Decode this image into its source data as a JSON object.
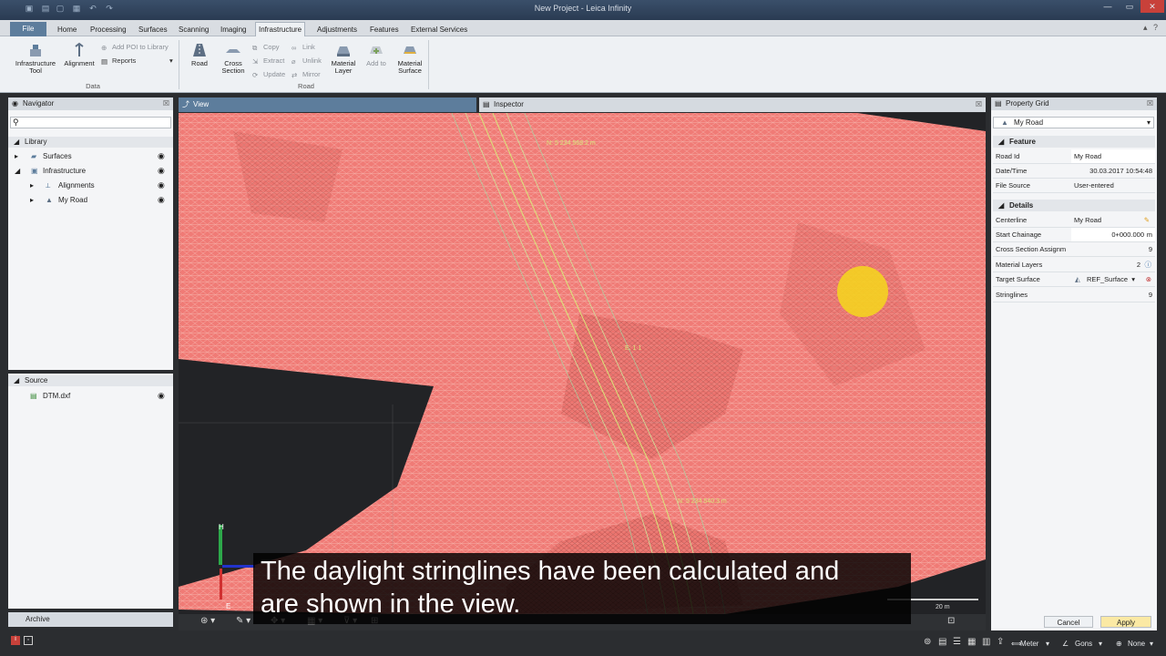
{
  "window": {
    "title": "New Project - Leica Infinity"
  },
  "ribbon_tabs": [
    "File",
    "Home",
    "Processing",
    "Surfaces",
    "Scanning",
    "Imaging",
    "Infrastructure",
    "Adjustments",
    "Features",
    "External Services"
  ],
  "ribbon": {
    "infrastructure_tool": "Infrastructure Tool",
    "alignment": "Alignment",
    "add_poi": "Add POI to Library",
    "reports": "Reports",
    "data_group": "Data",
    "road": "Road",
    "cross_section": "Cross Section",
    "copy": "Copy",
    "extract": "Extract",
    "update": "Update",
    "link": "Link",
    "unlink": "Unlink",
    "mirror": "Mirror",
    "material_layer": "Material Layer",
    "add_to": "Add to",
    "material_surface": "Material Surface",
    "road_group": "Road"
  },
  "navigator": {
    "title": "Navigator",
    "library": "Library",
    "items": [
      "Surfaces",
      "Infrastructure",
      "Alignments",
      "My Road"
    ],
    "source_title": "Source",
    "source_items": [
      "DTM.dxf"
    ],
    "archive": "Archive"
  },
  "view_tabs": {
    "view": "View",
    "inspector": "Inspector"
  },
  "viewport": {
    "annotations": [
      "N: 5 234 568.2 m",
      "N: 5 234 540.3 m",
      "E: 1 1"
    ],
    "scale": "20 m",
    "axis_h": "H",
    "axis_e": "E"
  },
  "subtitle": {
    "line1": "The daylight stringlines have been calculated and",
    "line2": "are shown in the view."
  },
  "property_grid": {
    "title": "Property Grid",
    "selector": "My Road",
    "feature_section": "Feature",
    "details_section": "Details",
    "feature": [
      {
        "k": "Road Id",
        "v": "My Road"
      },
      {
        "k": "Date/Time",
        "v": "30.03.2017 10:54:48"
      },
      {
        "k": "File Source",
        "v": "User-entered"
      }
    ],
    "details": [
      {
        "k": "Centerline",
        "v": "My Road"
      },
      {
        "k": "Start Chainage",
        "v": "0+000.000",
        "unit": "m"
      },
      {
        "k": "Cross Section Assignm",
        "v": "9"
      },
      {
        "k": "Material Layers",
        "v": "2"
      },
      {
        "k": "Target Surface",
        "v": "REF_Surface"
      },
      {
        "k": "Stringlines",
        "v": "9"
      }
    ],
    "cancel": "Cancel",
    "apply": "Apply"
  },
  "status": {
    "units": "Meter",
    "angles": "Gons",
    "none": "None"
  },
  "colors": {
    "mesh": "#f07b76",
    "accent": "#5d7d9c",
    "stringline": "#d8e67a"
  }
}
